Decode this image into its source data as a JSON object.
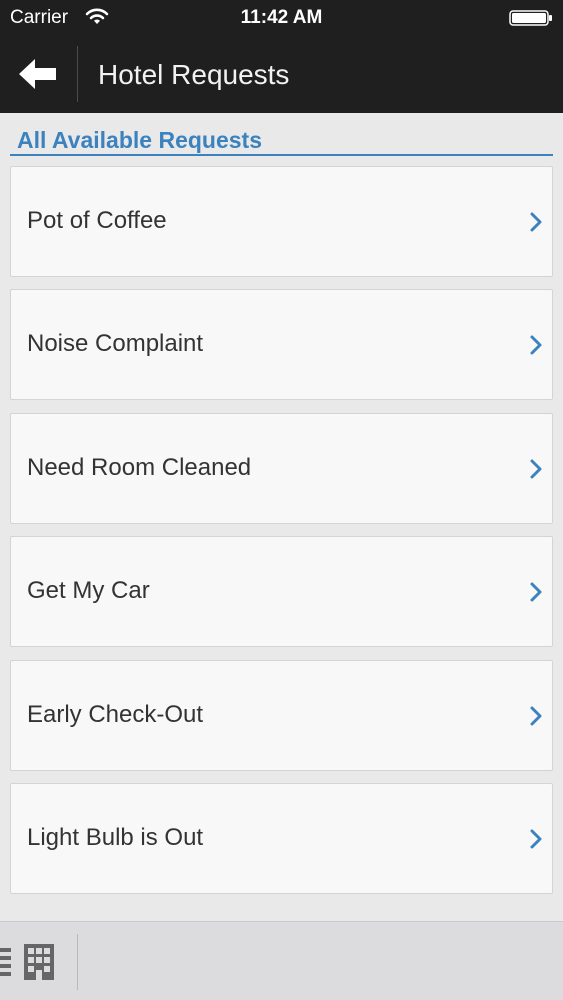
{
  "status_bar": {
    "carrier": "Carrier",
    "time": "11:42 AM",
    "icons": [
      "wifi-icon",
      "battery-icon"
    ]
  },
  "nav_bar": {
    "title": "Hotel Requests",
    "back_icon": "back-arrow-icon"
  },
  "section": {
    "heading": "All Available Requests"
  },
  "requests": [
    {
      "label": "Pot of Coffee"
    },
    {
      "label": "Noise Complaint"
    },
    {
      "label": "Need Room Cleaned"
    },
    {
      "label": "Get My Car"
    },
    {
      "label": "Early Check-Out"
    },
    {
      "label": "Light Bulb is Out"
    }
  ],
  "toolbar": {
    "icons": [
      "list-icon",
      "building-icon"
    ]
  },
  "colors": {
    "bar_background": "#1f1f20",
    "accent": "#3b82be",
    "page_background": "#e9e9ea",
    "card_background": "#f8f8f9",
    "text": "#333333"
  }
}
